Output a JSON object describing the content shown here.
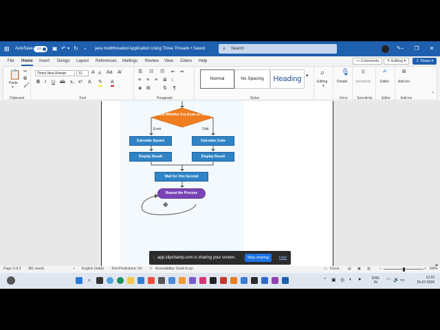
{
  "titlebar": {
    "autosave_label": "AutoSave",
    "autosave_state": "On",
    "doc_title": "java multithreaded Application Using Three Threads • Saved",
    "search_placeholder": "Search",
    "accent": "#1e5fae"
  },
  "menu": {
    "tabs": [
      "File",
      "Home",
      "Insert",
      "Design",
      "Layout",
      "References",
      "Mailings",
      "Review",
      "View",
      "Zotero",
      "Help"
    ],
    "active_tab": "Home",
    "comments_label": "Comments",
    "editing_label": "Editing",
    "share_label": "Share"
  },
  "ribbon": {
    "clipboard": {
      "paste_label": "Paste",
      "group_label": "Clipboard"
    },
    "font": {
      "font_name": "Times New Roman",
      "font_size": "12",
      "group_label": "Font"
    },
    "paragraph": {
      "group_label": "Paragraph"
    },
    "styles": {
      "items": [
        "Normal",
        "No Spacing",
        "Heading"
      ],
      "group_label": "Styles"
    },
    "editing": {
      "label": "Editing"
    },
    "voice": {
      "dictate_label": "Dictate",
      "group_label": "Voice"
    },
    "sensitivity": {
      "label": "Sensitivity",
      "group_label": "Sensitivity"
    },
    "editor": {
      "label": "Editor",
      "group_label": "Editor"
    },
    "addins": {
      "label": "Add-ins",
      "group_label": "Add-ins"
    }
  },
  "diagram": {
    "decision": "Check Whether It Is Even or Odd?",
    "branch_even": "Even",
    "branch_odd": "Odd",
    "calc_square": "Calculate Square",
    "calc_cube": "Calculate Cube",
    "display_left": "Display Result",
    "display_right": "Display Result",
    "wait": "Wait for One Second",
    "repeat": "Repeat the Process",
    "colors": {
      "decision": "#f07d1f",
      "process": "#2f84c6",
      "repeat": "#7a44b5"
    }
  },
  "share_notice": {
    "text": "app.clipchamp.com is sharing your screen.",
    "stop_label": "Stop sharing",
    "hide_label": "Hide"
  },
  "statusbar": {
    "page": "Page 3 of 3",
    "words": "381 words",
    "language": "English (India)",
    "text_predictions": "Text Predictions: On",
    "accessibility": "Accessibility: Good to go",
    "focus": "Focus",
    "zoom": "100%"
  },
  "taskbar": {
    "lang_top": "ENG",
    "lang_bottom": "IN",
    "time": "12:22",
    "date": "26-07-2026"
  }
}
